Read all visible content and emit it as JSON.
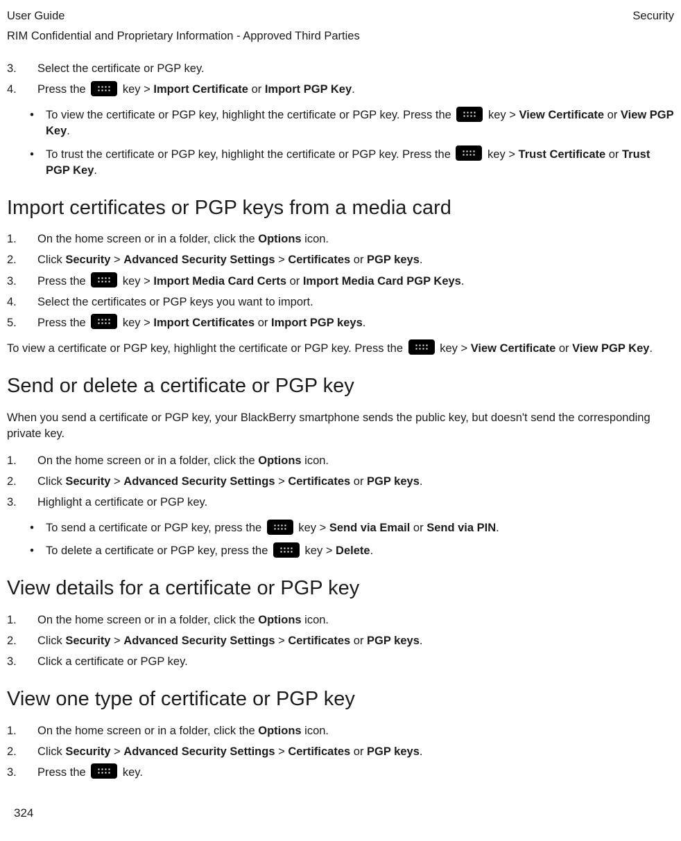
{
  "header": {
    "left": "User Guide",
    "right": "Security"
  },
  "confidential": "RIM Confidential and Proprietary Information - Approved Third Parties",
  "top_list": {
    "item3": {
      "num": "3.",
      "text": "Select the certificate or PGP key."
    },
    "item4": {
      "num": "4.",
      "p1": "Press the ",
      "p2": " key > ",
      "b1": "Import Certificate",
      "p3": " or ",
      "b2": "Import PGP Key",
      "p4": "."
    }
  },
  "top_bullets": {
    "a": {
      "p1": "To view the certificate or PGP key, highlight the certificate or PGP key. Press the ",
      "p2": " key > ",
      "b1": "View Certificate",
      "p3": " or ",
      "b2": "View PGP Key",
      "p4": "."
    },
    "b": {
      "p1": "To trust the certificate or PGP key, highlight the certificate or PGP key. Press the ",
      "p2": " key > ",
      "b1": "Trust Certificate",
      "p3": " or ",
      "b2": "Trust PGP Key",
      "p4": "."
    }
  },
  "h_import": "Import certificates or PGP keys from a media card",
  "import_list": {
    "i1": {
      "num": "1.",
      "p1": "On the home screen or in a folder, click the ",
      "b1": "Options",
      "p2": " icon."
    },
    "i2": {
      "num": "2.",
      "p1": "Click ",
      "b1": "Security",
      "p2": " > ",
      "b2": "Advanced Security Settings",
      "p3": " > ",
      "b3": "Certificates",
      "p4": " or ",
      "b4": "PGP keys",
      "p5": "."
    },
    "i3": {
      "num": "3.",
      "p1": " Press the ",
      "p2": " key > ",
      "b1": "Import Media Card Certs",
      "p3": " or ",
      "b2": "Import Media Card PGP Keys",
      "p4": "."
    },
    "i4": {
      "num": "4.",
      "p1": "Select the certificates or PGP keys you want to import."
    },
    "i5": {
      "num": "5.",
      "p1": " Press the ",
      "p2": " key > ",
      "b1": "Import Certificates",
      "p3": " or ",
      "b2": "Import PGP keys",
      "p4": "."
    }
  },
  "import_note": {
    "p1": "To view a certificate or PGP key, highlight the certificate or PGP key. Press the ",
    "p2": " key > ",
    "b1": "View Certificate",
    "p3": " or ",
    "b2": "View PGP Key",
    "p4": "."
  },
  "h_send": "Send or delete a certificate or PGP key",
  "send_intro": "When you send a certificate or PGP key, your BlackBerry smartphone sends the public key, but doesn't send the corresponding private key.",
  "send_list": {
    "i1": {
      "num": "1.",
      "p1": "On the home screen or in a folder, click the ",
      "b1": "Options",
      "p2": " icon."
    },
    "i2": {
      "num": "2.",
      "p1": "Click ",
      "b1": "Security",
      "p2": " > ",
      "b2": "Advanced Security Settings",
      "p3": " > ",
      "b3": "Certificates",
      "p4": " or ",
      "b4": "PGP keys",
      "p5": "."
    },
    "i3": {
      "num": "3.",
      "p1": "Highlight a certificate or PGP key."
    }
  },
  "send_bullets": {
    "a": {
      "p1": "To send a certificate or PGP key, press the ",
      "p2": " key > ",
      "b1": "Send via Email",
      "p3": " or ",
      "b2": "Send via PIN",
      "p4": "."
    },
    "b": {
      "p1": "To delete a certificate or PGP key, press the ",
      "p2": " key > ",
      "b1": "Delete",
      "p3": "."
    }
  },
  "h_details": "View details for a certificate or PGP key",
  "details_list": {
    "i1": {
      "num": "1.",
      "p1": "On the home screen or in a folder, click the ",
      "b1": "Options",
      "p2": " icon."
    },
    "i2": {
      "num": "2.",
      "p1": "Click ",
      "b1": "Security",
      "p2": " > ",
      "b2": "Advanced Security Settings",
      "p3": " > ",
      "b3": "Certificates",
      "p4": " or ",
      "b4": "PGP keys",
      "p5": "."
    },
    "i3": {
      "num": "3.",
      "p1": "Click a certificate or PGP key."
    }
  },
  "h_type": "View one type of certificate or PGP key",
  "type_list": {
    "i1": {
      "num": "1.",
      "p1": "On the home screen or in a folder, click the ",
      "b1": "Options",
      "p2": " icon."
    },
    "i2": {
      "num": "2.",
      "p1": "Click ",
      "b1": "Security",
      "p2": " > ",
      "b2": "Advanced Security Settings",
      "p3": " > ",
      "b3": "Certificates",
      "p4": " or ",
      "b4": "PGP keys",
      "p5": "."
    },
    "i3": {
      "num": "3.",
      "p1": " Press the ",
      "p2": " key."
    }
  },
  "page_number": "324"
}
